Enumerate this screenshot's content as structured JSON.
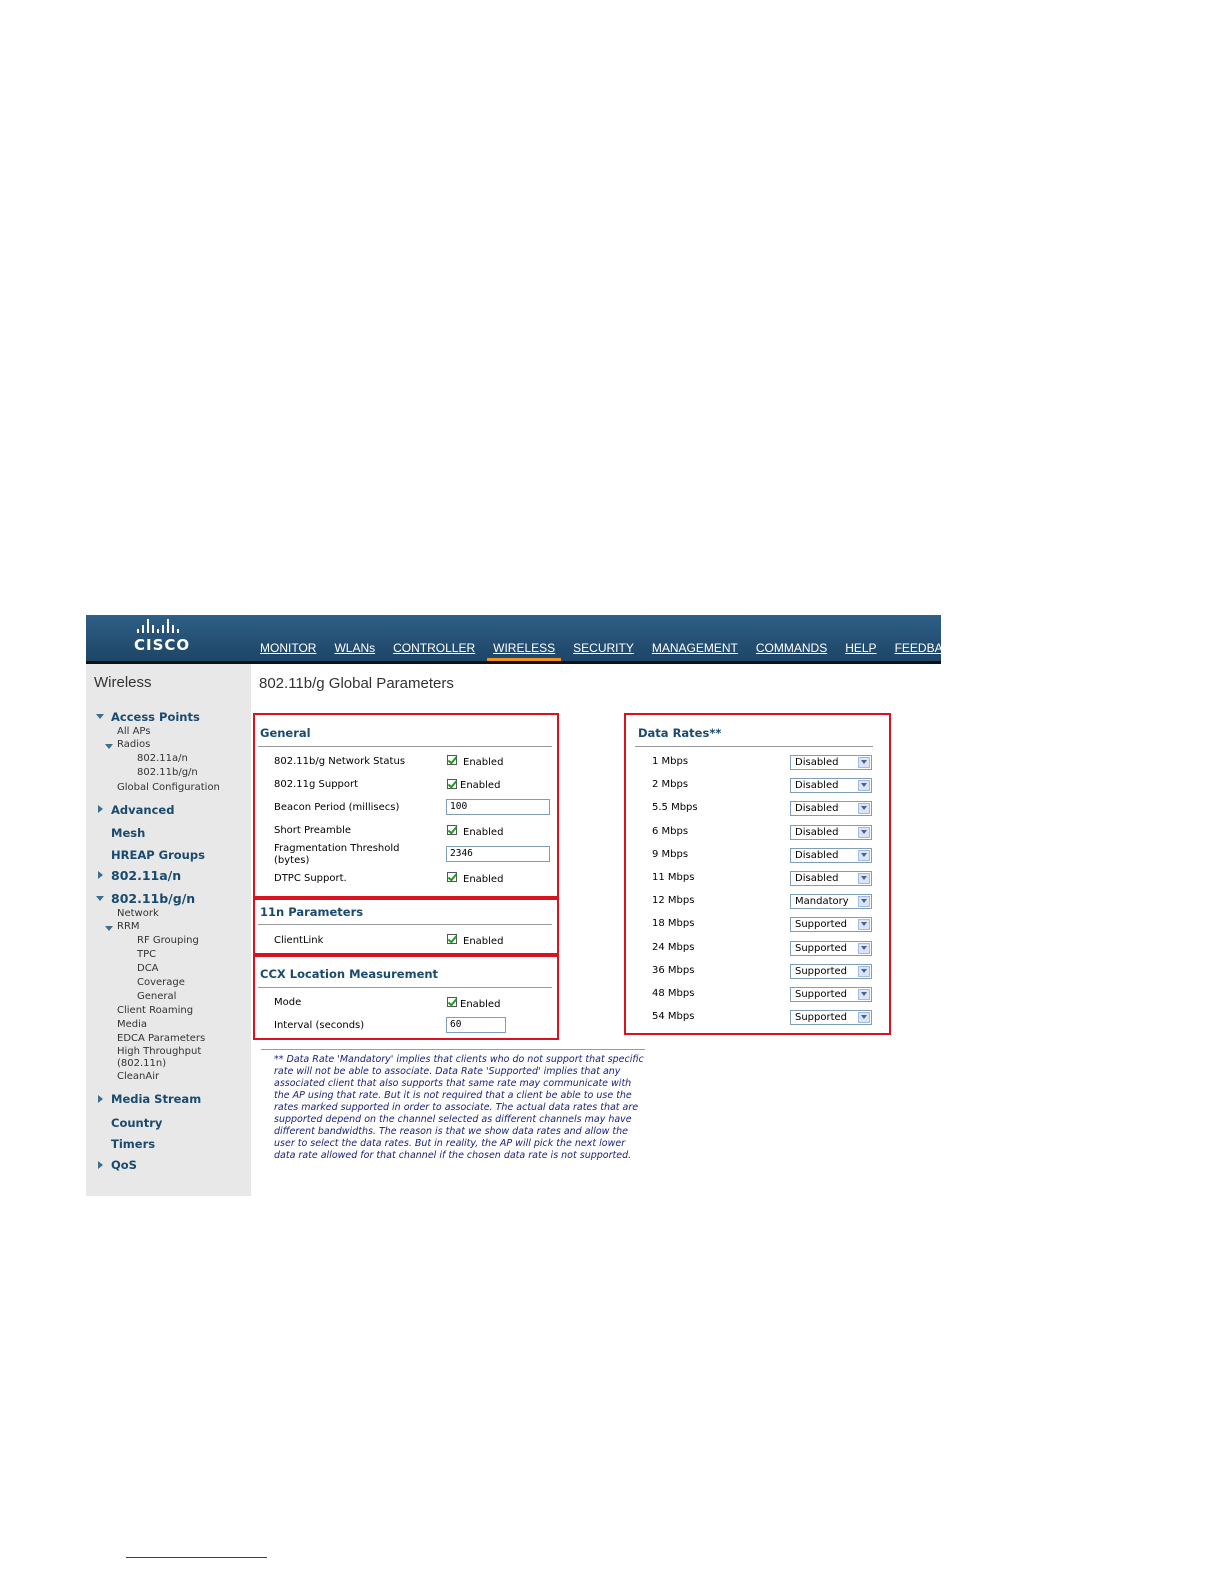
{
  "logo": {
    "text": "CISCO"
  },
  "nav": {
    "items": [
      "MONITOR",
      "WLANs",
      "CONTROLLER",
      "WIRELESS",
      "SECURITY",
      "MANAGEMENT",
      "COMMANDS",
      "HELP",
      "FEEDBACK"
    ],
    "active": "WIRELESS"
  },
  "sidebar": {
    "title": "Wireless",
    "access_points": "Access Points",
    "all_aps": "All APs",
    "radios": "Radios",
    "radio_a": "802.11a/n",
    "radio_bg": "802.11b/g/n",
    "global_config": "Global Configuration",
    "advanced": "Advanced",
    "mesh": "Mesh",
    "hreap": "HREAP Groups",
    "r11an": "802.11a/n",
    "r11bgn": "802.11b/g/n",
    "network": "Network",
    "rrm": "RRM",
    "rf_grouping": "RF Grouping",
    "tpc": "TPC",
    "dca": "DCA",
    "coverage": "Coverage",
    "general": "General",
    "client_roaming": "Client Roaming",
    "media": "Media",
    "edca": "EDCA Parameters",
    "high_throughput": "High Throughput",
    "ht_sub": "(802.11n)",
    "cleanair": "CleanAir",
    "media_stream": "Media Stream",
    "country": "Country",
    "timers": "Timers",
    "qos": "QoS"
  },
  "page": {
    "title": "802.11b/g Global Parameters"
  },
  "general": {
    "title": "General",
    "network_status_label": "802.11b/g Network Status",
    "network_status_value": "Enabled",
    "g_support_label": "802.11g Support",
    "g_support_value": "Enabled",
    "beacon_label": "Beacon Period (millisecs)",
    "beacon_value": "100",
    "short_preamble_label": "Short Preamble",
    "short_preamble_value": "Enabled",
    "frag_label_1": "Fragmentation Threshold",
    "frag_label_2": "(bytes)",
    "frag_value": "2346",
    "dtpc_label": "DTPC Support.",
    "dtpc_value": "Enabled"
  },
  "n11": {
    "title": "11n Parameters",
    "clientlink_label": "ClientLink",
    "clientlink_value": "Enabled"
  },
  "ccx": {
    "title": "CCX Location Measurement",
    "mode_label": "Mode",
    "mode_value": "Enabled",
    "interval_label": "Interval (seconds)",
    "interval_value": "60"
  },
  "data_rates": {
    "title": "Data Rates**",
    "rows": [
      {
        "rate": "1 Mbps",
        "value": "Disabled"
      },
      {
        "rate": "2 Mbps",
        "value": "Disabled"
      },
      {
        "rate": "5.5 Mbps",
        "value": "Disabled"
      },
      {
        "rate": "6 Mbps",
        "value": "Disabled"
      },
      {
        "rate": "9 Mbps",
        "value": "Disabled"
      },
      {
        "rate": "11 Mbps",
        "value": "Disabled"
      },
      {
        "rate": "12 Mbps",
        "value": "Mandatory"
      },
      {
        "rate": "18 Mbps",
        "value": "Supported"
      },
      {
        "rate": "24 Mbps",
        "value": "Supported"
      },
      {
        "rate": "36 Mbps",
        "value": "Supported"
      },
      {
        "rate": "48 Mbps",
        "value": "Supported"
      },
      {
        "rate": "54 Mbps",
        "value": "Supported"
      }
    ]
  },
  "footnote": "** Data Rate 'Mandatory' implies that clients who do not support that specific rate will not be able to associate. Data Rate 'Supported' implies that any associated client that also supports that same rate may communicate with the AP using that rate. But it is not required that a client be able to use the rates marked supported in order to associate. The actual data rates that are supported depend on the channel selected as different channels may have different bandwidths. The reason is that we show data rates and allow the user to select the data rates. But in reality, the AP will pick the next lower data rate allowed for that channel if the chosen data rate is not supported.",
  "colors": {
    "accent": "#d8121f",
    "brand": "#1d4566",
    "active_tab": "#f0901e",
    "footnote": "#1a237e"
  }
}
